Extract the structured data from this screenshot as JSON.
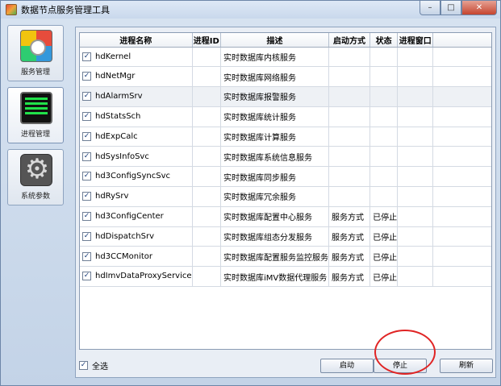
{
  "window": {
    "title": "数据节点服务管理工具",
    "close_glyph": "✕",
    "min_glyph": "–",
    "max_glyph": "□"
  },
  "sidebar": {
    "items": [
      {
        "label": "服务管理",
        "icon": "service-management-icon"
      },
      {
        "label": "进程管理",
        "icon": "process-monitor-icon"
      },
      {
        "label": "系统参数",
        "icon": "gear-icon"
      }
    ]
  },
  "table": {
    "columns": [
      "进程名称",
      "进程ID",
      "描述",
      "启动方式",
      "状态",
      "进程窗口"
    ],
    "rows": [
      {
        "checked": true,
        "name": "hdKernel",
        "pid": "",
        "desc": "实时数据库内核服务",
        "start": "",
        "status": "",
        "window": ""
      },
      {
        "checked": true,
        "name": "hdNetMgr",
        "pid": "",
        "desc": "实时数据库网络服务",
        "start": "",
        "status": "",
        "window": ""
      },
      {
        "checked": true,
        "name": "hdAlarmSrv",
        "pid": "",
        "desc": "实时数据库报警服务",
        "start": "",
        "status": "",
        "window": ""
      },
      {
        "checked": true,
        "name": "hdStatsSch",
        "pid": "",
        "desc": "实时数据库统计服务",
        "start": "",
        "status": "",
        "window": ""
      },
      {
        "checked": true,
        "name": "hdExpCalc",
        "pid": "",
        "desc": "实时数据库计算服务",
        "start": "",
        "status": "",
        "window": ""
      },
      {
        "checked": true,
        "name": "hdSysInfoSvc",
        "pid": "",
        "desc": "实时数据库系统信息服务",
        "start": "",
        "status": "",
        "window": ""
      },
      {
        "checked": true,
        "name": "hd3ConfigSyncSvc",
        "pid": "",
        "desc": "实时数据库同步服务",
        "start": "",
        "status": "",
        "window": ""
      },
      {
        "checked": true,
        "name": "hdRySrv",
        "pid": "",
        "desc": "实时数据库冗余服务",
        "start": "",
        "status": "",
        "window": ""
      },
      {
        "checked": true,
        "name": "hd3ConfigCenter",
        "pid": "",
        "desc": "实时数据库配置中心服务",
        "start": "服务方式",
        "status": "已停止",
        "window": ""
      },
      {
        "checked": true,
        "name": "hdDispatchSrv",
        "pid": "",
        "desc": "实时数据库组态分发服务",
        "start": "服务方式",
        "status": "已停止",
        "window": ""
      },
      {
        "checked": true,
        "name": "hd3CCMonitor",
        "pid": "",
        "desc": "实时数据库配置服务监控服务",
        "start": "服务方式",
        "status": "已停止",
        "window": ""
      },
      {
        "checked": true,
        "name": "hdImvDataProxyService",
        "pid": "",
        "desc": "实时数据库iMV数据代理服务",
        "start": "服务方式",
        "status": "已停止",
        "window": ""
      }
    ]
  },
  "footer": {
    "select_all_label": "全选",
    "select_all_checked": true,
    "start_label": "启动",
    "stop_label": "停止",
    "refresh_label": "刷新"
  },
  "colors": {
    "highlight_circle": "#e02424",
    "highlight_row": "#eef1f5"
  }
}
